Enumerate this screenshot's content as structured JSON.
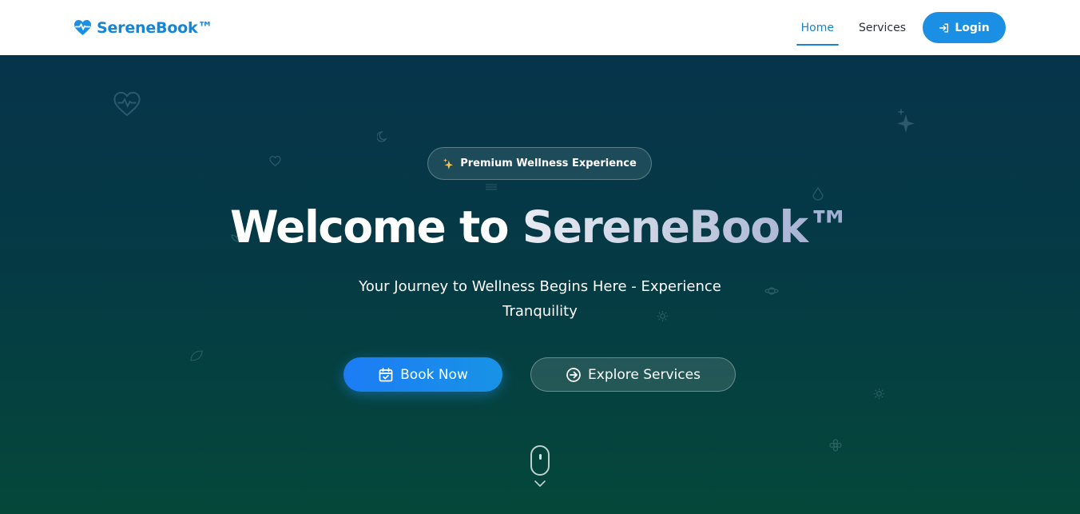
{
  "navbar": {
    "brand": "SereneBook™",
    "brand_icon": "heart-pulse-icon",
    "links": [
      {
        "label": "Home",
        "active": true
      },
      {
        "label": "Services",
        "active": false
      }
    ],
    "login_label": "Login",
    "login_icon": "sign-in-icon"
  },
  "hero": {
    "badge_text": "Premium Wellness Experience",
    "badge_icon": "sparkle-icon",
    "title_part1": "Welcome to",
    "title_part2": "SereneBook™",
    "subtitle": "Your Journey to Wellness Begins Here - Experience Tranquility",
    "book_label": "Book Now",
    "book_icon": "calendar-check-icon",
    "explore_label": "Explore Services",
    "explore_icon": "arrow-circle-right-icon",
    "scroll_icon": "mouse-scroll-icon"
  },
  "colors": {
    "brand": "#1585d8",
    "login_bg": "#1a8fe3",
    "hero_top": "#06344a",
    "hero_bottom": "#05483a",
    "book_button": "#1c7cf5"
  }
}
